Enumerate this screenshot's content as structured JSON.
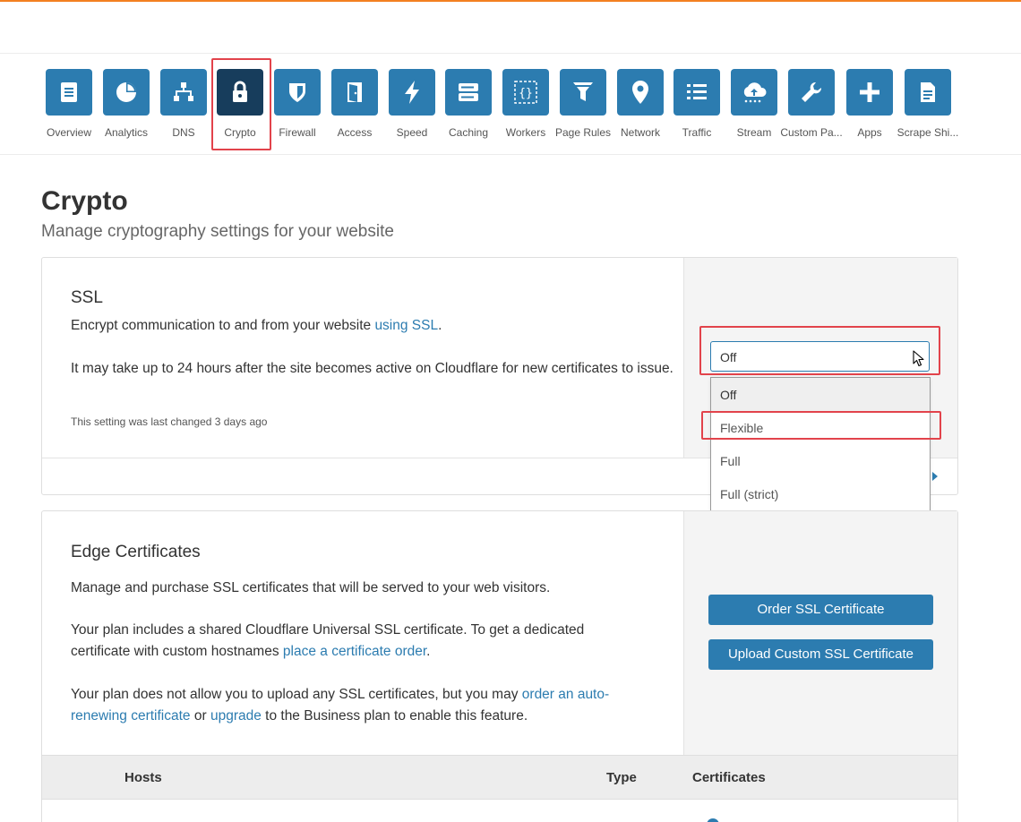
{
  "nav": {
    "items": [
      {
        "label": "Overview",
        "icon": "overview-icon"
      },
      {
        "label": "Analytics",
        "icon": "analytics-icon"
      },
      {
        "label": "DNS",
        "icon": "dns-icon"
      },
      {
        "label": "Crypto",
        "icon": "lock-icon",
        "active": true
      },
      {
        "label": "Firewall",
        "icon": "shield-icon"
      },
      {
        "label": "Access",
        "icon": "door-icon"
      },
      {
        "label": "Speed",
        "icon": "bolt-icon"
      },
      {
        "label": "Caching",
        "icon": "server-icon"
      },
      {
        "label": "Workers",
        "icon": "braces-icon"
      },
      {
        "label": "Page Rules",
        "icon": "filter-icon"
      },
      {
        "label": "Network",
        "icon": "location-pin-icon"
      },
      {
        "label": "Traffic",
        "icon": "list-icon"
      },
      {
        "label": "Stream",
        "icon": "cloud-upload-icon"
      },
      {
        "label": "Custom Pa...",
        "icon": "wrench-icon"
      },
      {
        "label": "Apps",
        "icon": "plus-icon"
      },
      {
        "label": "Scrape Shi...",
        "icon": "document-icon"
      }
    ]
  },
  "page": {
    "title": "Crypto",
    "subtitle": "Manage cryptography settings for your website"
  },
  "ssl": {
    "title": "SSL",
    "desc_before_link": "Encrypt communication to and from your website ",
    "desc_link": "using SSL",
    "desc_after_link": ".",
    "note": "It may take up to 24 hours after the site becomes active on Cloudflare for new certificates to issue.",
    "last_changed": "This setting was last changed 3 days ago",
    "select": {
      "value": "Off",
      "options": [
        "Off",
        "Flexible",
        "Full",
        "Full (strict)"
      ]
    }
  },
  "edge": {
    "title": "Edge Certificates",
    "p1": "Manage and purchase SSL certificates that will be served to your web visitors.",
    "p2_a": "Your plan includes a shared Cloudflare Universal SSL certificate. To get a dedicated",
    "p2_b": "certificate with custom hostnames ",
    "p2_link": "place a certificate order",
    "p2_end": ".",
    "p3_a": "Your plan does not allow you to upload any SSL certificates, but you may ",
    "p3_link1_a": "order an auto-",
    "p3_link1_b": "renewing certificate",
    "p3_mid": " or ",
    "p3_link2": "upgrade",
    "p3_end": " to the Business plan to enable this feature.",
    "order_button": "Order SSL Certificate",
    "upload_button": "Upload Custom SSL Certificate"
  },
  "table": {
    "headers": [
      "Hosts",
      "Type",
      "Certificates"
    ]
  },
  "colors": {
    "accent": "#2c7cb0",
    "active_nav": "#173d5c",
    "highlight": "#e2434b",
    "brand_orange": "#f38020"
  }
}
